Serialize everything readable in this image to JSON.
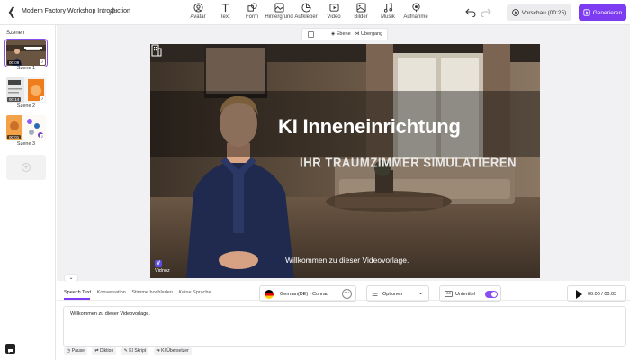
{
  "header": {
    "project_title": "Modern Factory Workshop Introduction",
    "tools": [
      {
        "label": "Avatar",
        "icon": "avatar-icon"
      },
      {
        "label": "Text",
        "icon": "text-icon"
      },
      {
        "label": "Form",
        "icon": "shape-icon"
      },
      {
        "label": "Hintergrund",
        "icon": "background-icon"
      },
      {
        "label": "Aufkleber",
        "icon": "sticker-icon"
      },
      {
        "label": "Video",
        "icon": "video-icon"
      },
      {
        "label": "Bilder",
        "icon": "image-icon"
      },
      {
        "label": "Musik",
        "icon": "music-icon"
      },
      {
        "label": "Aufnahme",
        "icon": "record-icon"
      }
    ],
    "preview_label": "Vorschau (00:25)",
    "generate_label": "Generieren"
  },
  "sidebar": {
    "title": "Szenen",
    "scenes": [
      {
        "label": "Szene 1",
        "duration": "00:09",
        "selected": true
      },
      {
        "label": "Szene 2",
        "duration": "00:14",
        "selected": false
      },
      {
        "label": "Szene 3",
        "duration": "00:01",
        "selected": false
      }
    ]
  },
  "canvas": {
    "toolbar": {
      "layer_label": "Ebene",
      "transition_label": "Übergang"
    },
    "title": "KI Inneneinrichtung",
    "subtitle": "IHR TRAUMZIMMER SIMULATIEREN",
    "caption": "Willkommen zu dieser Videovorlage.",
    "watermark": "Vidnoz"
  },
  "editor": {
    "tabs": [
      "Speech Text",
      "Konversation",
      "Stimme hochladen",
      "Keine Sprache"
    ],
    "active_tab": "Speech Text",
    "voice": "German(DE) - Conrad",
    "options_label": "Optionen",
    "subtitle_label": "Untertitel",
    "subtitle_enabled": true,
    "time": "00:00 / 00:03",
    "script_text": "Willkommen zu dieser Videovorlage.",
    "chips": [
      "Pause",
      "Diktion",
      "KI Skript",
      "KI Übersetzer"
    ]
  },
  "colors": {
    "accent": "#7d3cf2",
    "border": "#e6e6e6"
  }
}
